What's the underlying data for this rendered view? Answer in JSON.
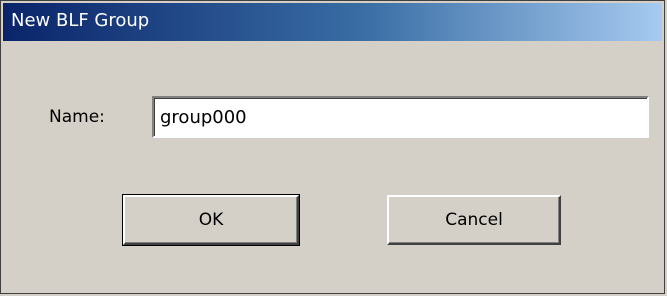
{
  "window": {
    "title": "New BLF Group"
  },
  "form": {
    "name_label": "Name:",
    "name_value": "group000"
  },
  "buttons": {
    "ok_label": "OK",
    "cancel_label": "Cancel"
  },
  "colors": {
    "titlebar_start": "#0a246a",
    "titlebar_end": "#a6caf0",
    "dialog_bg": "#d4d0c8"
  }
}
